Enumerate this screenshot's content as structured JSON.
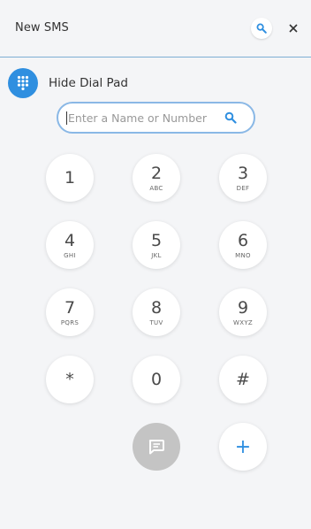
{
  "header": {
    "title": "New SMS"
  },
  "dialpad_toggle": {
    "label": "Hide Dial Pad"
  },
  "search": {
    "placeholder": "Enter a Name or Number",
    "value": ""
  },
  "keys": [
    {
      "digit": "1",
      "letters": ""
    },
    {
      "digit": "2",
      "letters": "ABC"
    },
    {
      "digit": "3",
      "letters": "DEF"
    },
    {
      "digit": "4",
      "letters": "GHI"
    },
    {
      "digit": "5",
      "letters": "JKL"
    },
    {
      "digit": "6",
      "letters": "MNO"
    },
    {
      "digit": "7",
      "letters": "PQRS"
    },
    {
      "digit": "8",
      "letters": "TUV"
    },
    {
      "digit": "9",
      "letters": "WXYZ"
    },
    {
      "digit": "*",
      "letters": ""
    },
    {
      "digit": "0",
      "letters": ""
    },
    {
      "digit": "#",
      "letters": ""
    }
  ],
  "actions": {
    "add_label": "+",
    "message_icon": "chat-bubble-icon"
  },
  "colors": {
    "accent": "#2f8fe0",
    "divider": "#7eaed4",
    "field_border": "#8ab8e6",
    "disabled_button": "#c4c4c4"
  }
}
